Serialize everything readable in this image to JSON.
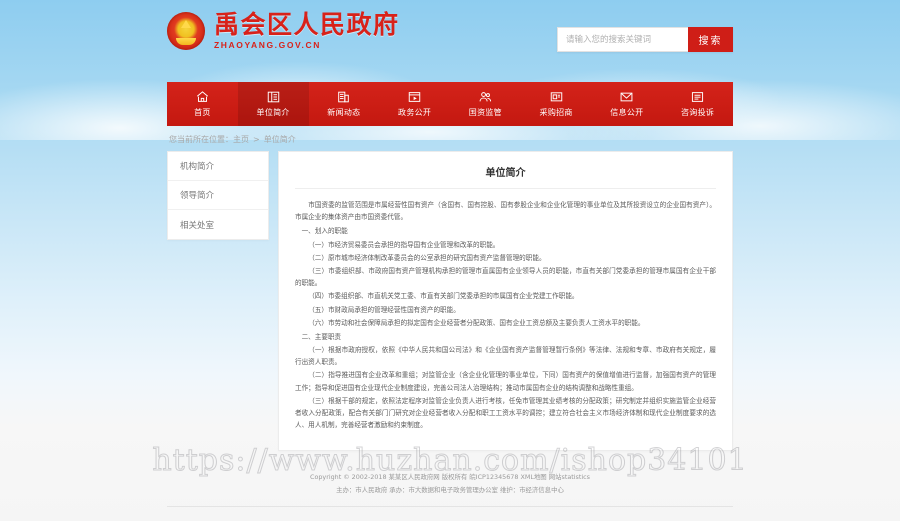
{
  "site": {
    "title": "禹会区人民政府",
    "domain": "ZHAOYANG.GOV.CN",
    "emblem_icon": "national-emblem-icon"
  },
  "search": {
    "placeholder": "请输入您的搜索关键词",
    "value": "",
    "button_label": "搜索"
  },
  "nav": {
    "items": [
      {
        "label": "首页",
        "icon": "home-icon",
        "active": false
      },
      {
        "label": "单位简介",
        "icon": "building-icon",
        "active": true
      },
      {
        "label": "新闻动态",
        "icon": "news-icon",
        "active": false
      },
      {
        "label": "政务公开",
        "icon": "video-icon",
        "active": false
      },
      {
        "label": "国资监管",
        "icon": "people-icon",
        "active": false
      },
      {
        "label": "采购招商",
        "icon": "presentation-icon",
        "active": false
      },
      {
        "label": "信息公开",
        "icon": "envelope-icon",
        "active": false
      },
      {
        "label": "咨询投诉",
        "icon": "document-lines-icon",
        "active": false
      }
    ]
  },
  "breadcrumb": {
    "prefix": "您当前所在位置：",
    "home": "主页",
    "separator": ">",
    "current": "单位简介"
  },
  "sidebar": {
    "items": [
      {
        "label": "机构简介"
      },
      {
        "label": "领导简介"
      },
      {
        "label": "相关处室"
      }
    ]
  },
  "article": {
    "title": "单位简介",
    "paragraphs": [
      {
        "style": "indent",
        "text": "市国资委的监管范围是市属经营性国有资产（含国有、国有控股、国有参股企业和企业化管理的事业单位及其所投资设立的企业国有资产）。市属企业的集体资产由市国资委代管。"
      },
      {
        "style": "sec",
        "text": "一、划入的职能"
      },
      {
        "style": "indent",
        "text": "（一）市经济贸易委员会承担的指导国有企业管理和改革的职能。"
      },
      {
        "style": "indent",
        "text": "（二）原市城市经济体制改革委员会的公室承担的研究国有资产监督管理的职能。"
      },
      {
        "style": "indent",
        "text": "（三）市委组织部、市政府国有资产管理机构承担的管理市直属国有企业领导人员的职能，市直有关部门党委承担的管理市属国有企业干部的职能。"
      },
      {
        "style": "indent",
        "text": "（四）市委组织部、市直机关党工委、市直有关部门党委承担的市属国有企业党建工作职能。"
      },
      {
        "style": "indent",
        "text": "（五）市财政局承担的管理经营性国有资产的职能。"
      },
      {
        "style": "indent",
        "text": "（六）市劳动和社会保障局承担的拟定国有企业经营者分配政策、国有企业工资总额及主要负责人工资水平的职能。"
      },
      {
        "style": "sec",
        "text": "二、主要职责"
      },
      {
        "style": "indent",
        "text": "（一）根据市政府授权，依照《中华人民共和国公司法》和《企业国有资产监督管理暂行条例》等法律、法规和专章、市政府有关规定，履行出资人职责。"
      },
      {
        "style": "indent",
        "text": "（二）指导推进国有企业改革和重组；对监管企业（含企业化管理的事业单位，下同）国有资产的保值增值进行监督，加强国有资产的管理工作；指导和促进国有企业现代企业制度建设，完善公司法人治理结构；推动市属国有企业的结构调整和战略性重组。"
      },
      {
        "style": "indent",
        "text": "（三）根据干部的规定，依照法定程序对监管企业负责人进行考核，任免市管理其业绩考核的分配政策；研究制定并组织实施监管企业经营者收入分配政策，配合有关部门门研究对企业经营者收入分配和职工工资水平的调控；建立符合社会主义市场经济体制和现代企业制度要求的选人、用人机制，完善经营者激励和约束制度。"
      }
    ]
  },
  "watermark": {
    "text": "https://www.huzhan.com/ishop34101"
  },
  "footer": {
    "line1": "Copyright © 2002-2018 某某区人民政府网 版权所有 皖ICP12345678 XML地图 网站statistics",
    "line2": "主办：市人民政府  承办：市大数据和电子政务管理办公室  维护：市经济信息中心"
  },
  "colors": {
    "brand_red": "#d4231a",
    "nav_red": "#c41810",
    "button_red": "#cf1e17",
    "sky_top": "#8ecdf0",
    "page_bg": "#f5f5f5"
  }
}
